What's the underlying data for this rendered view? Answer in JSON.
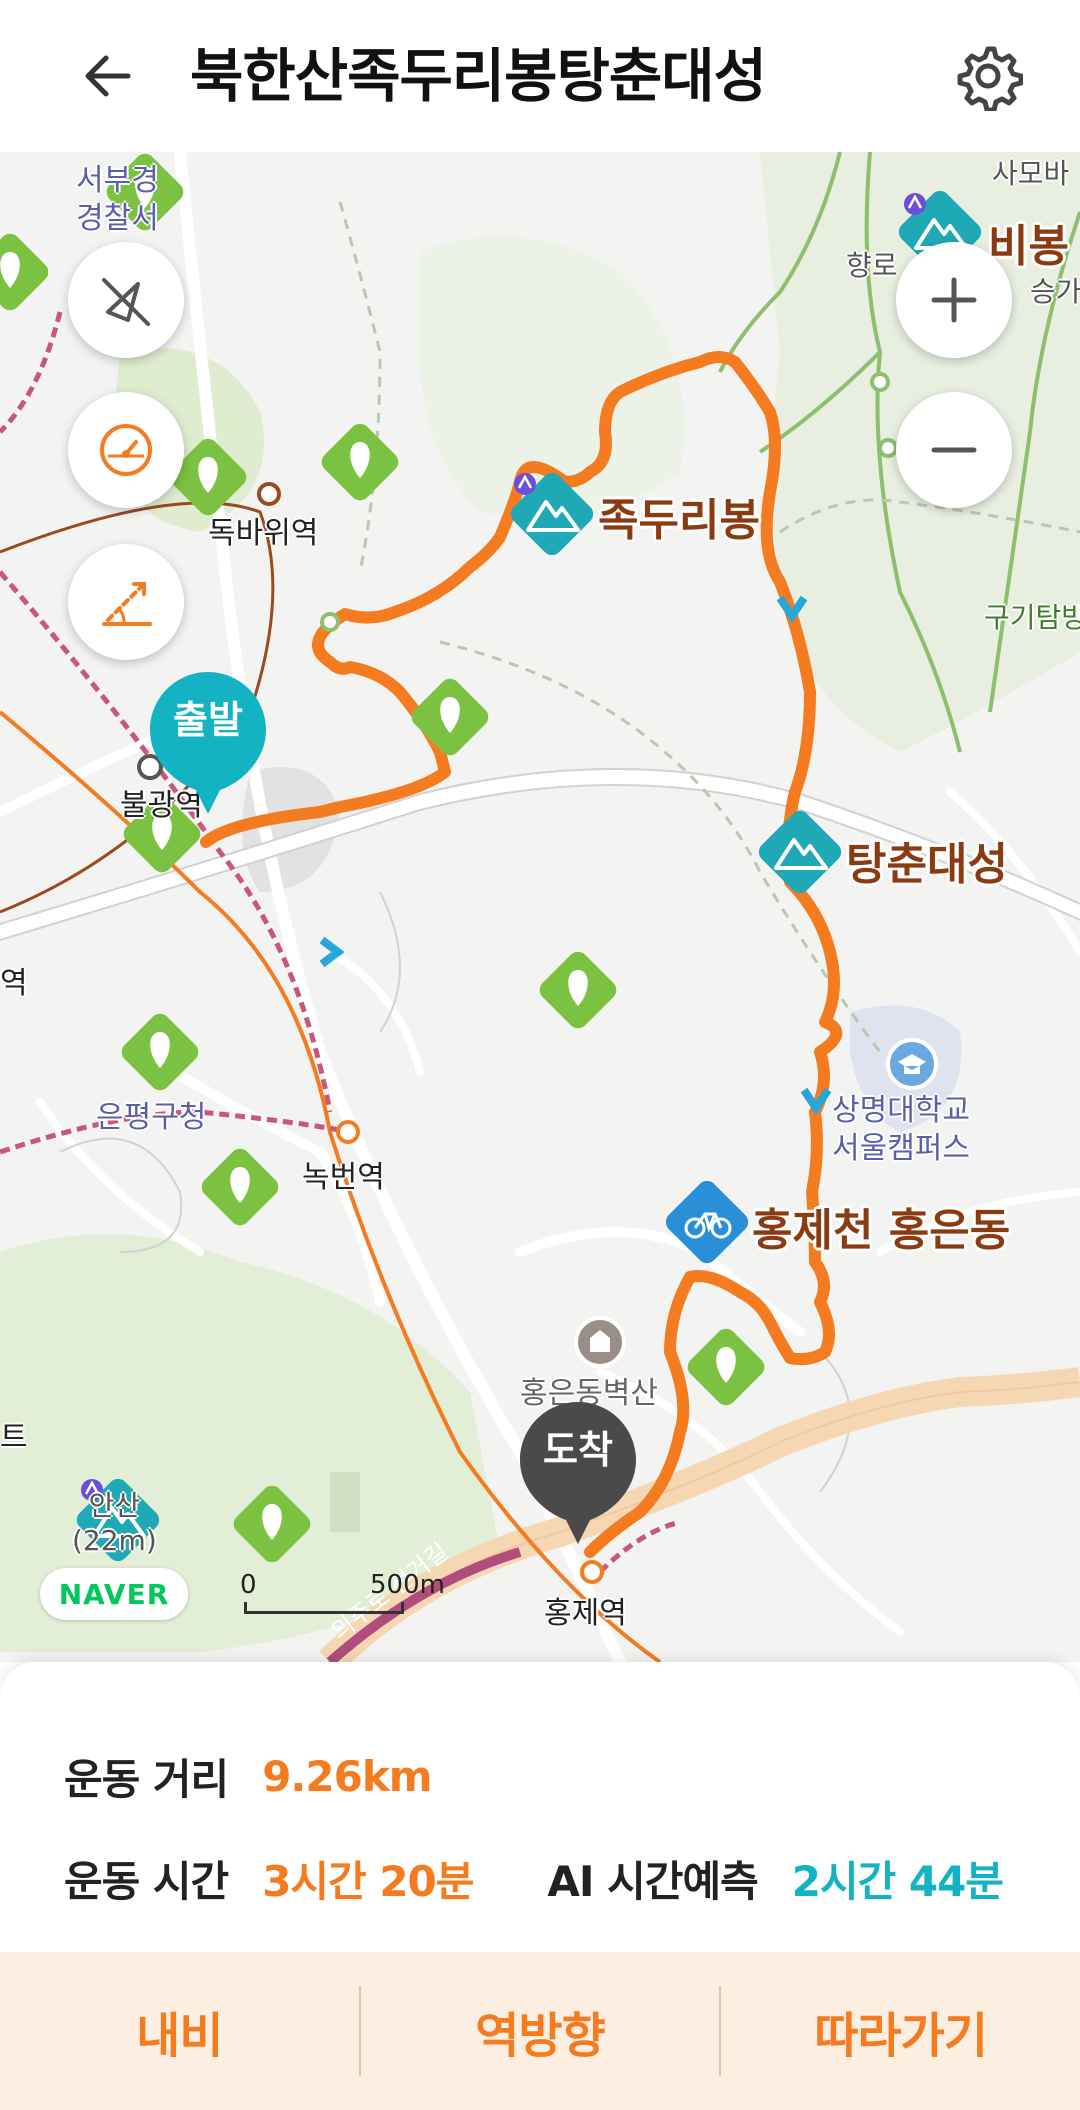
{
  "header": {
    "title": "북한산족두리봉탕춘대성",
    "back_icon": "arrow-left-icon",
    "settings_icon": "gear-icon"
  },
  "map": {
    "controls": {
      "zoom_in": "+",
      "zoom_out": "−"
    },
    "pins": {
      "start": "출발",
      "end": "도착"
    },
    "places": {
      "jokduribong": "족두리봉",
      "tangchundaeseong": "탕춘대성",
      "hongjecheon": "홍제천 홍은동",
      "bibong": "비봉"
    },
    "stations": {
      "dokbawi": "독바위역",
      "bulgwang": "불광역",
      "nokbeon": "녹번역",
      "hongje": "홍제역"
    },
    "labels": {
      "seobu_police": "서부경\n경찰서",
      "eunpyeong_office": "은평구청",
      "sangmyung_univ": "상명대학교\n서울캠퍼스",
      "hongeun_hall": "홍은동벽산",
      "guragi": "구기탐방",
      "hyangno": "향로",
      "seung": "승가",
      "saboi": "사모바",
      "tl_edge": "역",
      "bl_edge": "트",
      "anhill": "안산\n(22m)",
      "road_name": "의주로 전거길"
    },
    "naver": "NAVER",
    "scale": {
      "zero": "0",
      "distance": "500m"
    },
    "colors": {
      "route": "#f47b20",
      "teal": "#1fa8b5",
      "pin_dark": "#4a4a4a"
    }
  },
  "info": {
    "distance_label": "운동 거리",
    "distance_value": "9.26km",
    "time_label": "운동 시간",
    "time_value": "3시간 20분",
    "ai_label": "AI 시간예측",
    "ai_value": "2시간 44분"
  },
  "actions": {
    "navi": "내비",
    "reverse": "역방향",
    "follow": "따라가기"
  }
}
